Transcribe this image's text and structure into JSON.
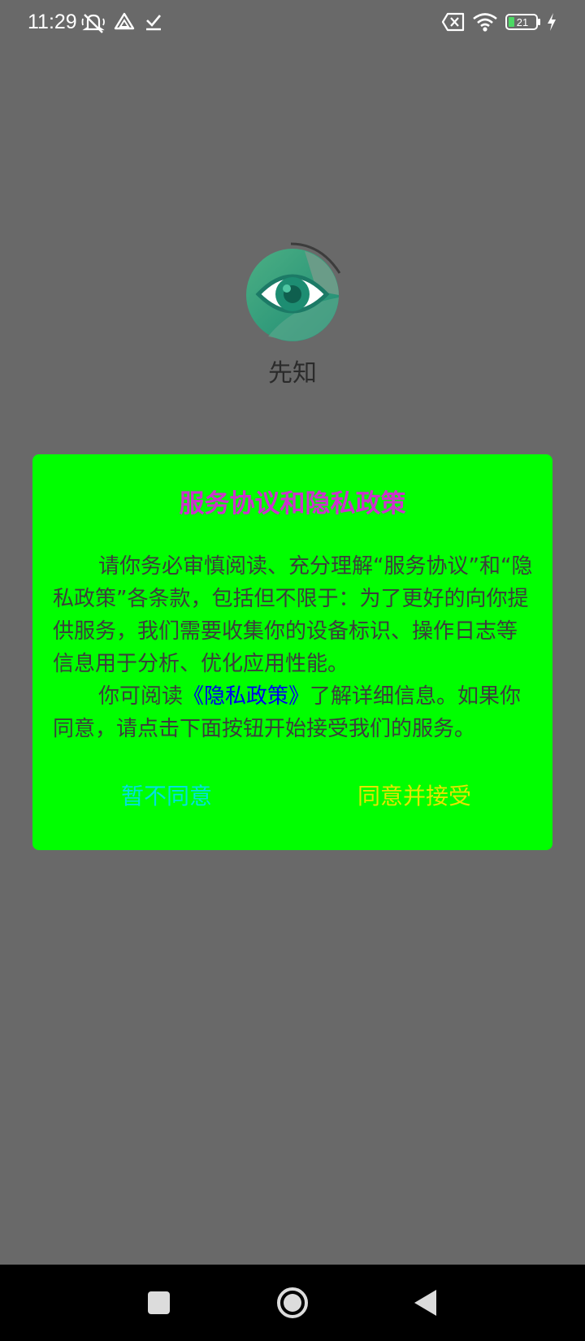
{
  "status_bar": {
    "time": "11:29",
    "battery": "21",
    "icons": [
      "mute-bell-icon",
      "drive-icon",
      "download-done-icon",
      "sim-off-icon",
      "wifi-icon",
      "battery-icon",
      "charging-icon"
    ]
  },
  "app": {
    "name": "先知",
    "logo_icon": "eye-logo-icon"
  },
  "dialog": {
    "title": "服务协议和隐私政策",
    "paragraph1": "请你务必审慎阅读、充分理解“服务协议”和“隐私政策”各条款，包括但不限于：为了更好的向你提供服务，我们需要收集你的设备标识、操作日志等信息用于分析、优化应用性能。",
    "paragraph2_before": "你可阅读",
    "privacy_link": "《隐私政策》",
    "paragraph2_after": "了解详细信息。如果你同意，请点击下面按钮开始接受我们的服务。",
    "disagree_label": "暂不同意",
    "agree_label": "同意并接受"
  },
  "nav_bar": {
    "buttons": [
      "recents-square-icon",
      "home-circle-icon",
      "back-triangle-icon"
    ]
  },
  "colors": {
    "background": "#696969",
    "dialog_background": "#00ff00",
    "title": "#cc33cc",
    "link": "#0000ee",
    "disagree": "#00e0e0",
    "agree": "#e5e500"
  }
}
